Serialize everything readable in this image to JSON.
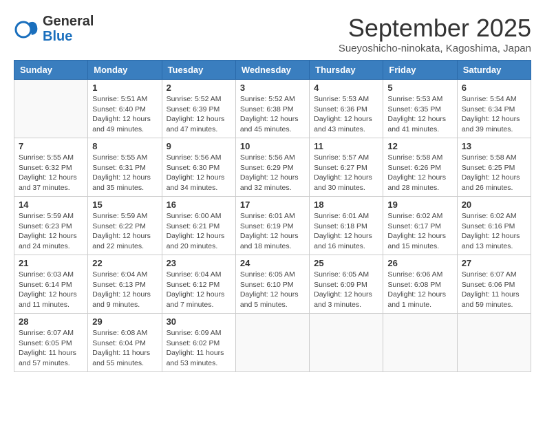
{
  "header": {
    "logo_line1": "General",
    "logo_line2": "Blue",
    "month": "September 2025",
    "location": "Sueyoshicho-ninokata, Kagoshima, Japan"
  },
  "weekdays": [
    "Sunday",
    "Monday",
    "Tuesday",
    "Wednesday",
    "Thursday",
    "Friday",
    "Saturday"
  ],
  "weeks": [
    [
      null,
      {
        "day": "1",
        "sunrise": "5:51 AM",
        "sunset": "6:40 PM",
        "daylight": "12 hours and 49 minutes."
      },
      {
        "day": "2",
        "sunrise": "5:52 AM",
        "sunset": "6:39 PM",
        "daylight": "12 hours and 47 minutes."
      },
      {
        "day": "3",
        "sunrise": "5:52 AM",
        "sunset": "6:38 PM",
        "daylight": "12 hours and 45 minutes."
      },
      {
        "day": "4",
        "sunrise": "5:53 AM",
        "sunset": "6:36 PM",
        "daylight": "12 hours and 43 minutes."
      },
      {
        "day": "5",
        "sunrise": "5:53 AM",
        "sunset": "6:35 PM",
        "daylight": "12 hours and 41 minutes."
      },
      {
        "day": "6",
        "sunrise": "5:54 AM",
        "sunset": "6:34 PM",
        "daylight": "12 hours and 39 minutes."
      }
    ],
    [
      {
        "day": "7",
        "sunrise": "5:55 AM",
        "sunset": "6:32 PM",
        "daylight": "12 hours and 37 minutes."
      },
      {
        "day": "8",
        "sunrise": "5:55 AM",
        "sunset": "6:31 PM",
        "daylight": "12 hours and 35 minutes."
      },
      {
        "day": "9",
        "sunrise": "5:56 AM",
        "sunset": "6:30 PM",
        "daylight": "12 hours and 34 minutes."
      },
      {
        "day": "10",
        "sunrise": "5:56 AM",
        "sunset": "6:29 PM",
        "daylight": "12 hours and 32 minutes."
      },
      {
        "day": "11",
        "sunrise": "5:57 AM",
        "sunset": "6:27 PM",
        "daylight": "12 hours and 30 minutes."
      },
      {
        "day": "12",
        "sunrise": "5:58 AM",
        "sunset": "6:26 PM",
        "daylight": "12 hours and 28 minutes."
      },
      {
        "day": "13",
        "sunrise": "5:58 AM",
        "sunset": "6:25 PM",
        "daylight": "12 hours and 26 minutes."
      }
    ],
    [
      {
        "day": "14",
        "sunrise": "5:59 AM",
        "sunset": "6:23 PM",
        "daylight": "12 hours and 24 minutes."
      },
      {
        "day": "15",
        "sunrise": "5:59 AM",
        "sunset": "6:22 PM",
        "daylight": "12 hours and 22 minutes."
      },
      {
        "day": "16",
        "sunrise": "6:00 AM",
        "sunset": "6:21 PM",
        "daylight": "12 hours and 20 minutes."
      },
      {
        "day": "17",
        "sunrise": "6:01 AM",
        "sunset": "6:19 PM",
        "daylight": "12 hours and 18 minutes."
      },
      {
        "day": "18",
        "sunrise": "6:01 AM",
        "sunset": "6:18 PM",
        "daylight": "12 hours and 16 minutes."
      },
      {
        "day": "19",
        "sunrise": "6:02 AM",
        "sunset": "6:17 PM",
        "daylight": "12 hours and 15 minutes."
      },
      {
        "day": "20",
        "sunrise": "6:02 AM",
        "sunset": "6:16 PM",
        "daylight": "12 hours and 13 minutes."
      }
    ],
    [
      {
        "day": "21",
        "sunrise": "6:03 AM",
        "sunset": "6:14 PM",
        "daylight": "12 hours and 11 minutes."
      },
      {
        "day": "22",
        "sunrise": "6:04 AM",
        "sunset": "6:13 PM",
        "daylight": "12 hours and 9 minutes."
      },
      {
        "day": "23",
        "sunrise": "6:04 AM",
        "sunset": "6:12 PM",
        "daylight": "12 hours and 7 minutes."
      },
      {
        "day": "24",
        "sunrise": "6:05 AM",
        "sunset": "6:10 PM",
        "daylight": "12 hours and 5 minutes."
      },
      {
        "day": "25",
        "sunrise": "6:05 AM",
        "sunset": "6:09 PM",
        "daylight": "12 hours and 3 minutes."
      },
      {
        "day": "26",
        "sunrise": "6:06 AM",
        "sunset": "6:08 PM",
        "daylight": "12 hours and 1 minute."
      },
      {
        "day": "27",
        "sunrise": "6:07 AM",
        "sunset": "6:06 PM",
        "daylight": "11 hours and 59 minutes."
      }
    ],
    [
      {
        "day": "28",
        "sunrise": "6:07 AM",
        "sunset": "6:05 PM",
        "daylight": "11 hours and 57 minutes."
      },
      {
        "day": "29",
        "sunrise": "6:08 AM",
        "sunset": "6:04 PM",
        "daylight": "11 hours and 55 minutes."
      },
      {
        "day": "30",
        "sunrise": "6:09 AM",
        "sunset": "6:02 PM",
        "daylight": "11 hours and 53 minutes."
      },
      null,
      null,
      null,
      null
    ]
  ],
  "labels": {
    "sunrise": "Sunrise:",
    "sunset": "Sunset:",
    "daylight": "Daylight:"
  }
}
